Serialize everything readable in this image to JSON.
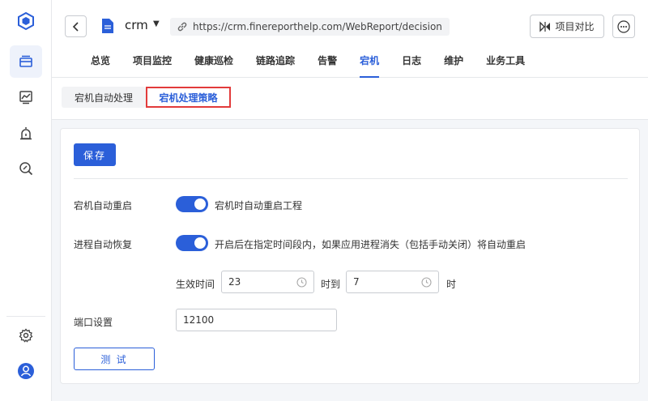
{
  "header": {
    "project_name": "crm",
    "url": "https://crm.finereporthelp.com/WebReport/decision",
    "compare_label": "项目对比"
  },
  "nav": {
    "items": [
      "总览",
      "项目监控",
      "健康巡检",
      "链路追踪",
      "告警",
      "宕机",
      "日志",
      "维护",
      "业务工具"
    ],
    "active": "宕机"
  },
  "subtabs": {
    "auto_handle": "宕机自动处理",
    "strategy": "宕机处理策略"
  },
  "panel": {
    "save_label": "保存",
    "auto_restart": {
      "label": "宕机自动重启",
      "enabled": true,
      "description": "宕机时自动重启工程"
    },
    "process_recover": {
      "label": "进程自动恢复",
      "enabled": true,
      "description": "开启后在指定时间段内，如果应用进程消失（包括手动关闭）将自动重启"
    },
    "effective_time": {
      "label": "生效时间",
      "start": "23",
      "to": "时到",
      "end": "7",
      "unit": "时"
    },
    "port": {
      "label": "端口设置",
      "value": "12100"
    },
    "test_label": "测 试"
  },
  "icons": {
    "sidebar": [
      "logo-cube-icon",
      "projects-icon",
      "monitor-chart-icon",
      "alarm-icon",
      "search-wrench-icon",
      "settings-gear-icon",
      "user-avatar-icon"
    ]
  },
  "colors": {
    "accent": "#2b5fd9",
    "highlight_border": "#e23b3b"
  }
}
